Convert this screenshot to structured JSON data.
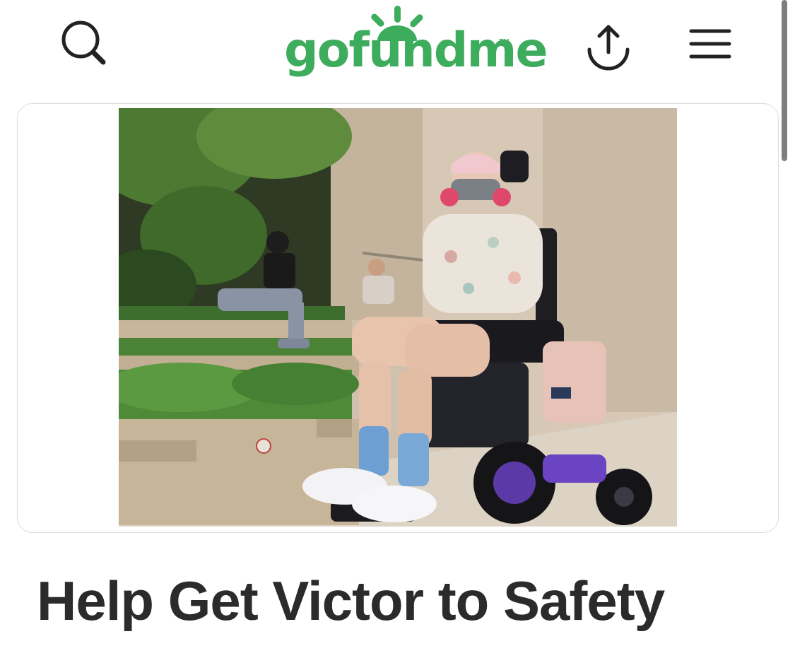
{
  "header": {
    "logo_text": "gofundme",
    "logo_trademark": "TM",
    "search_icon": "search-icon",
    "share_icon": "share-upload-icon",
    "menu_icon": "hamburger-menu-icon"
  },
  "colors": {
    "brand_green": "#3dac5d",
    "title_text": "#2b2b2b",
    "icon_stroke": "#222222",
    "card_border": "#dcdcdc",
    "scrollbar": "#7e7e7e"
  },
  "campaign": {
    "title": "Help Get Victor to Safety"
  }
}
